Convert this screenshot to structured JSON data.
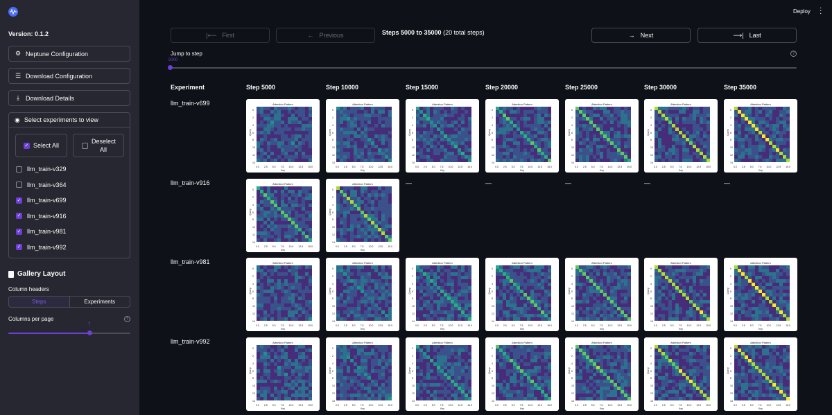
{
  "sidebar": {
    "version": "Version: 0.1.2",
    "buttons": {
      "neptune": "Neptune Configuration",
      "download_config": "Download Configuration",
      "download_details": "Download Details"
    },
    "expander_title": "Select experiments to view",
    "select_all": "Select All",
    "deselect_all": "Deselect All",
    "experiments": [
      {
        "label": "llm_train-v329",
        "checked": false
      },
      {
        "label": "llm_train-v364",
        "checked": false
      },
      {
        "label": "llm_train-v699",
        "checked": true
      },
      {
        "label": "llm_train-v916",
        "checked": true
      },
      {
        "label": "llm_train-v981",
        "checked": true
      },
      {
        "label": "llm_train-v992",
        "checked": true
      }
    ],
    "gallery_layout_title": "Gallery Layout",
    "column_headers_label": "Column headers",
    "column_header_options": [
      "Steps",
      "Experiments"
    ],
    "column_header_selected": "Steps",
    "columns_per_page_label": "Columns per page",
    "columns_per_page_value": "7",
    "help_glyph": "?"
  },
  "topbar": {
    "deploy": "Deploy",
    "menu_icon": "kebab-menu-icon"
  },
  "nav": {
    "first": "First",
    "previous": "Previous",
    "next": "Next",
    "last": "Last",
    "steps_range": "Steps 5000 to 35000",
    "steps_total": "(20 total steps)",
    "jump_label": "Jump to step",
    "jump_value": "5000",
    "help_glyph": "?"
  },
  "gallery": {
    "experiment_header": "Experiment",
    "steps": [
      "Step 5000",
      "Step 10000",
      "Step 15000",
      "Step 20000",
      "Step 25000",
      "Step 30000",
      "Step 35000"
    ],
    "plot_title": "Attention Pattern",
    "plot_xlabel": "Key",
    "plot_ylabel": "Query",
    "x_ticks": [
      "0.0",
      "2.5",
      "5.0",
      "7.5",
      "10.0",
      "12.5",
      "15.0"
    ],
    "y_ticks": [
      "0",
      "2",
      "4",
      "6",
      "8",
      "10",
      "12",
      "14"
    ],
    "missing_glyph": "—",
    "rows": [
      {
        "name": "llm_train-v699",
        "available": [
          1,
          1,
          1,
          1,
          1,
          1,
          1
        ]
      },
      {
        "name": "llm_train-v916",
        "available": [
          1,
          1,
          0,
          0,
          0,
          0,
          0
        ]
      },
      {
        "name": "llm_train-v981",
        "available": [
          1,
          1,
          1,
          1,
          1,
          1,
          1
        ]
      },
      {
        "name": "llm_train-v992",
        "available": [
          1,
          1,
          1,
          1,
          1,
          1,
          1
        ]
      }
    ]
  },
  "colors": {
    "accent": "#6c3fd6",
    "viridis_low": "#3b1f5c",
    "viridis_high": "#fde725"
  }
}
